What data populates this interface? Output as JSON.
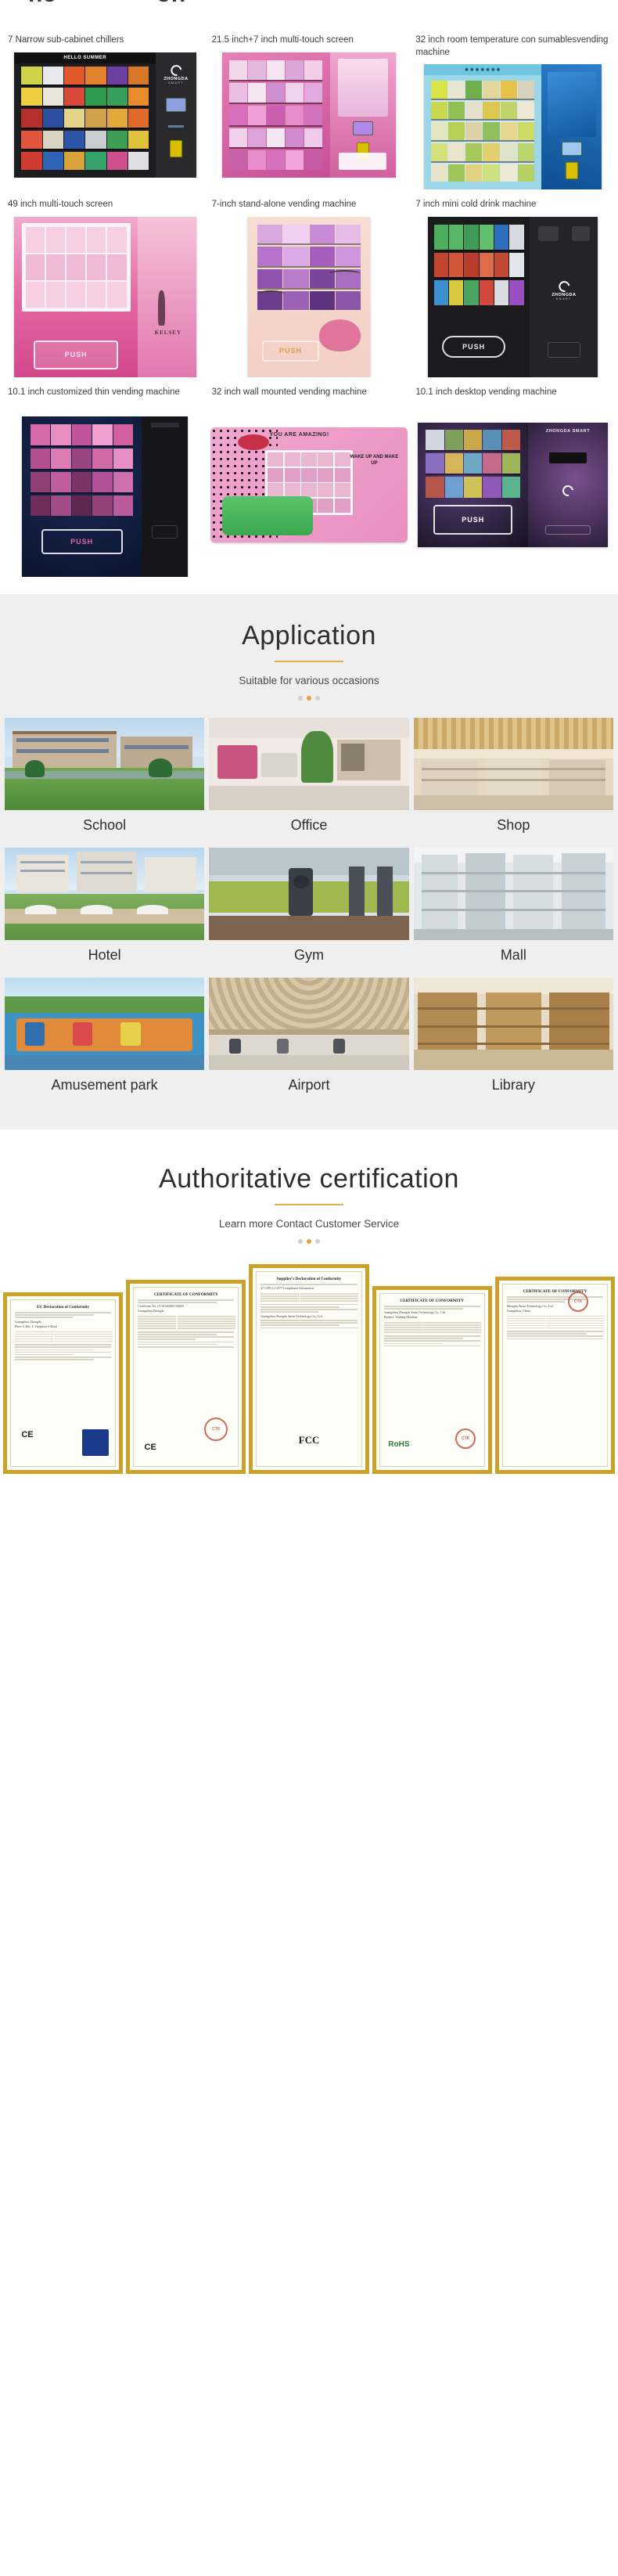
{
  "top_fragment": {
    "left": "ne",
    "right": "on"
  },
  "products": {
    "items": [
      {
        "title": "7 Narrow sub-cabinet chillers",
        "banner": "HELLO SUMMER",
        "brand": "ZHONGDA",
        "brand_sub": "SMART",
        "push": "PUSH",
        "style": "black-snack"
      },
      {
        "title": "21.5 inch+7 inch multi-touch screen",
        "banner": "",
        "brand": "",
        "brand_sub": "",
        "push": "",
        "style": "pink-cosmetic"
      },
      {
        "title": "32 inch room temperature con sumablesvending machine",
        "banner": "",
        "brand": "",
        "brand_sub": "",
        "push": "",
        "style": "cyan-drink"
      },
      {
        "title": "49 inch multi-touch screen",
        "banner": "",
        "brand": "KELSEY",
        "brand_sub": "",
        "push": "PUSH",
        "style": "pink-glitter"
      },
      {
        "title": "7-inch stand-alone vending machine",
        "banner": "",
        "brand": "",
        "brand_sub": "",
        "push": "PUSH",
        "style": "blush-lash"
      },
      {
        "title": "7 inch mini cold drink machine",
        "banner": "",
        "brand": "ZHONGDA",
        "brand_sub": "SMART",
        "push": "PUSH",
        "style": "black-mini"
      },
      {
        "title": "10.1 inch customized thin vending machine",
        "banner": "",
        "brand": "",
        "brand_sub": "",
        "push": "PUSH",
        "style": "blue-thin"
      },
      {
        "title": "32 inch wall mounted vending machine",
        "banner": "YOU ARE AMAZING!",
        "brand": "",
        "brand_sub": "",
        "push": "WAKE UP AND MAKE UP",
        "style": "wall-pop"
      },
      {
        "title": "10.1 inch desktop vending machine",
        "banner": "",
        "brand": "ZHONGDA SMART",
        "brand_sub": "",
        "push": "PUSH",
        "style": "nebula-desktop"
      }
    ]
  },
  "application": {
    "title": "Application",
    "subtitle": "Suitable for various occasions",
    "dots": 3,
    "active_dot": 1,
    "accent": "#e2a33c",
    "places": [
      {
        "label": "School"
      },
      {
        "label": "Office"
      },
      {
        "label": "Shop"
      },
      {
        "label": "Hotel"
      },
      {
        "label": "Gym"
      },
      {
        "label": "Mall"
      },
      {
        "label": "Amusement park"
      },
      {
        "label": "Airport"
      },
      {
        "label": "Library"
      }
    ]
  },
  "certification": {
    "title": "Authoritative certification",
    "subtitle": "Learn more Contact Customer Service",
    "dots": 3,
    "active_dot": 1,
    "accent": "#e2a33c",
    "certificates": [
      {
        "heading": "EU Declaration of Conformity",
        "company": "Guangzhou Zhongda",
        "line1": "Place 6, Rm. 4, Yangzhou 6 Road",
        "marks": "CE"
      },
      {
        "heading": "CERTIFICATE OF CONFORMITY",
        "company": "Guangzhou Zhongda",
        "line1": "Certificate No. CT181204001-00005",
        "marks": "CE"
      },
      {
        "heading": "Supplier's Declaration of Conformity",
        "company": "Guangzhou Zhongda Smart Technology Co., Ltd.",
        "line1": "47 CFR § 2.1077 Compliance Information",
        "marks": "FCC"
      },
      {
        "heading": "CERTIFICATE OF CONFORMITY",
        "company": "Guangzhou Zhongda Smart Technology Co., Ltd.",
        "line1": "Product: Vending Machine",
        "marks": "RoHS"
      },
      {
        "heading": "CERTIFICATE OF CONFORMITY",
        "company": "Zhongda Smart Technology Co., Ltd.",
        "line1": "Guangzhou, China",
        "marks": "CTK"
      }
    ]
  }
}
